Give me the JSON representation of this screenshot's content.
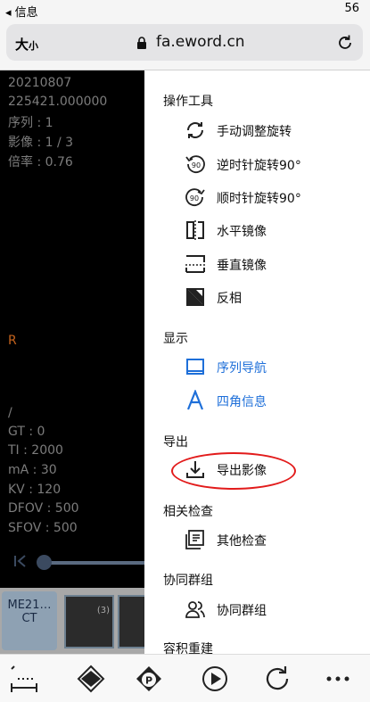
{
  "status": {
    "back_label": "◂ 信息",
    "right_text": "56"
  },
  "browser": {
    "text_size_big": "大",
    "text_size_small": "小",
    "url": "fa.eword.cn"
  },
  "viewer": {
    "info_top": [
      "20210807",
      "225421.000000",
      "序列 : 1",
      "影像 : 1 / 3",
      "倍率 : 0.76"
    ],
    "orientation": "R",
    "info_bottom": [
      "/",
      "GT : 0",
      "TI : 2000",
      "mA : 30",
      "KV : 120",
      "DFOV : 500",
      "SFOV : 500"
    ]
  },
  "thumbs": {
    "series_name": "ME21…",
    "series_modality": "CT",
    "thumb_count": "(3)"
  },
  "menu": {
    "tools_title": "操作工具",
    "tools": [
      "手动调整旋转",
      "逆时针旋转90°",
      "顺时针旋转90°",
      "水平镜像",
      "垂直镜像",
      "反相"
    ],
    "display_title": "显示",
    "display": [
      "序列导航",
      "四角信息"
    ],
    "export_title": "导出",
    "export": [
      "导出影像"
    ],
    "related_title": "相关检查",
    "related": [
      "其他检查"
    ],
    "collab_title": "协同群组",
    "collab": [
      "协同群组"
    ],
    "volume_title": "容积重建"
  },
  "colors": {
    "accent": "#1e6fd9",
    "highlight": "#e21b1b",
    "orientation": "#c4621c"
  }
}
